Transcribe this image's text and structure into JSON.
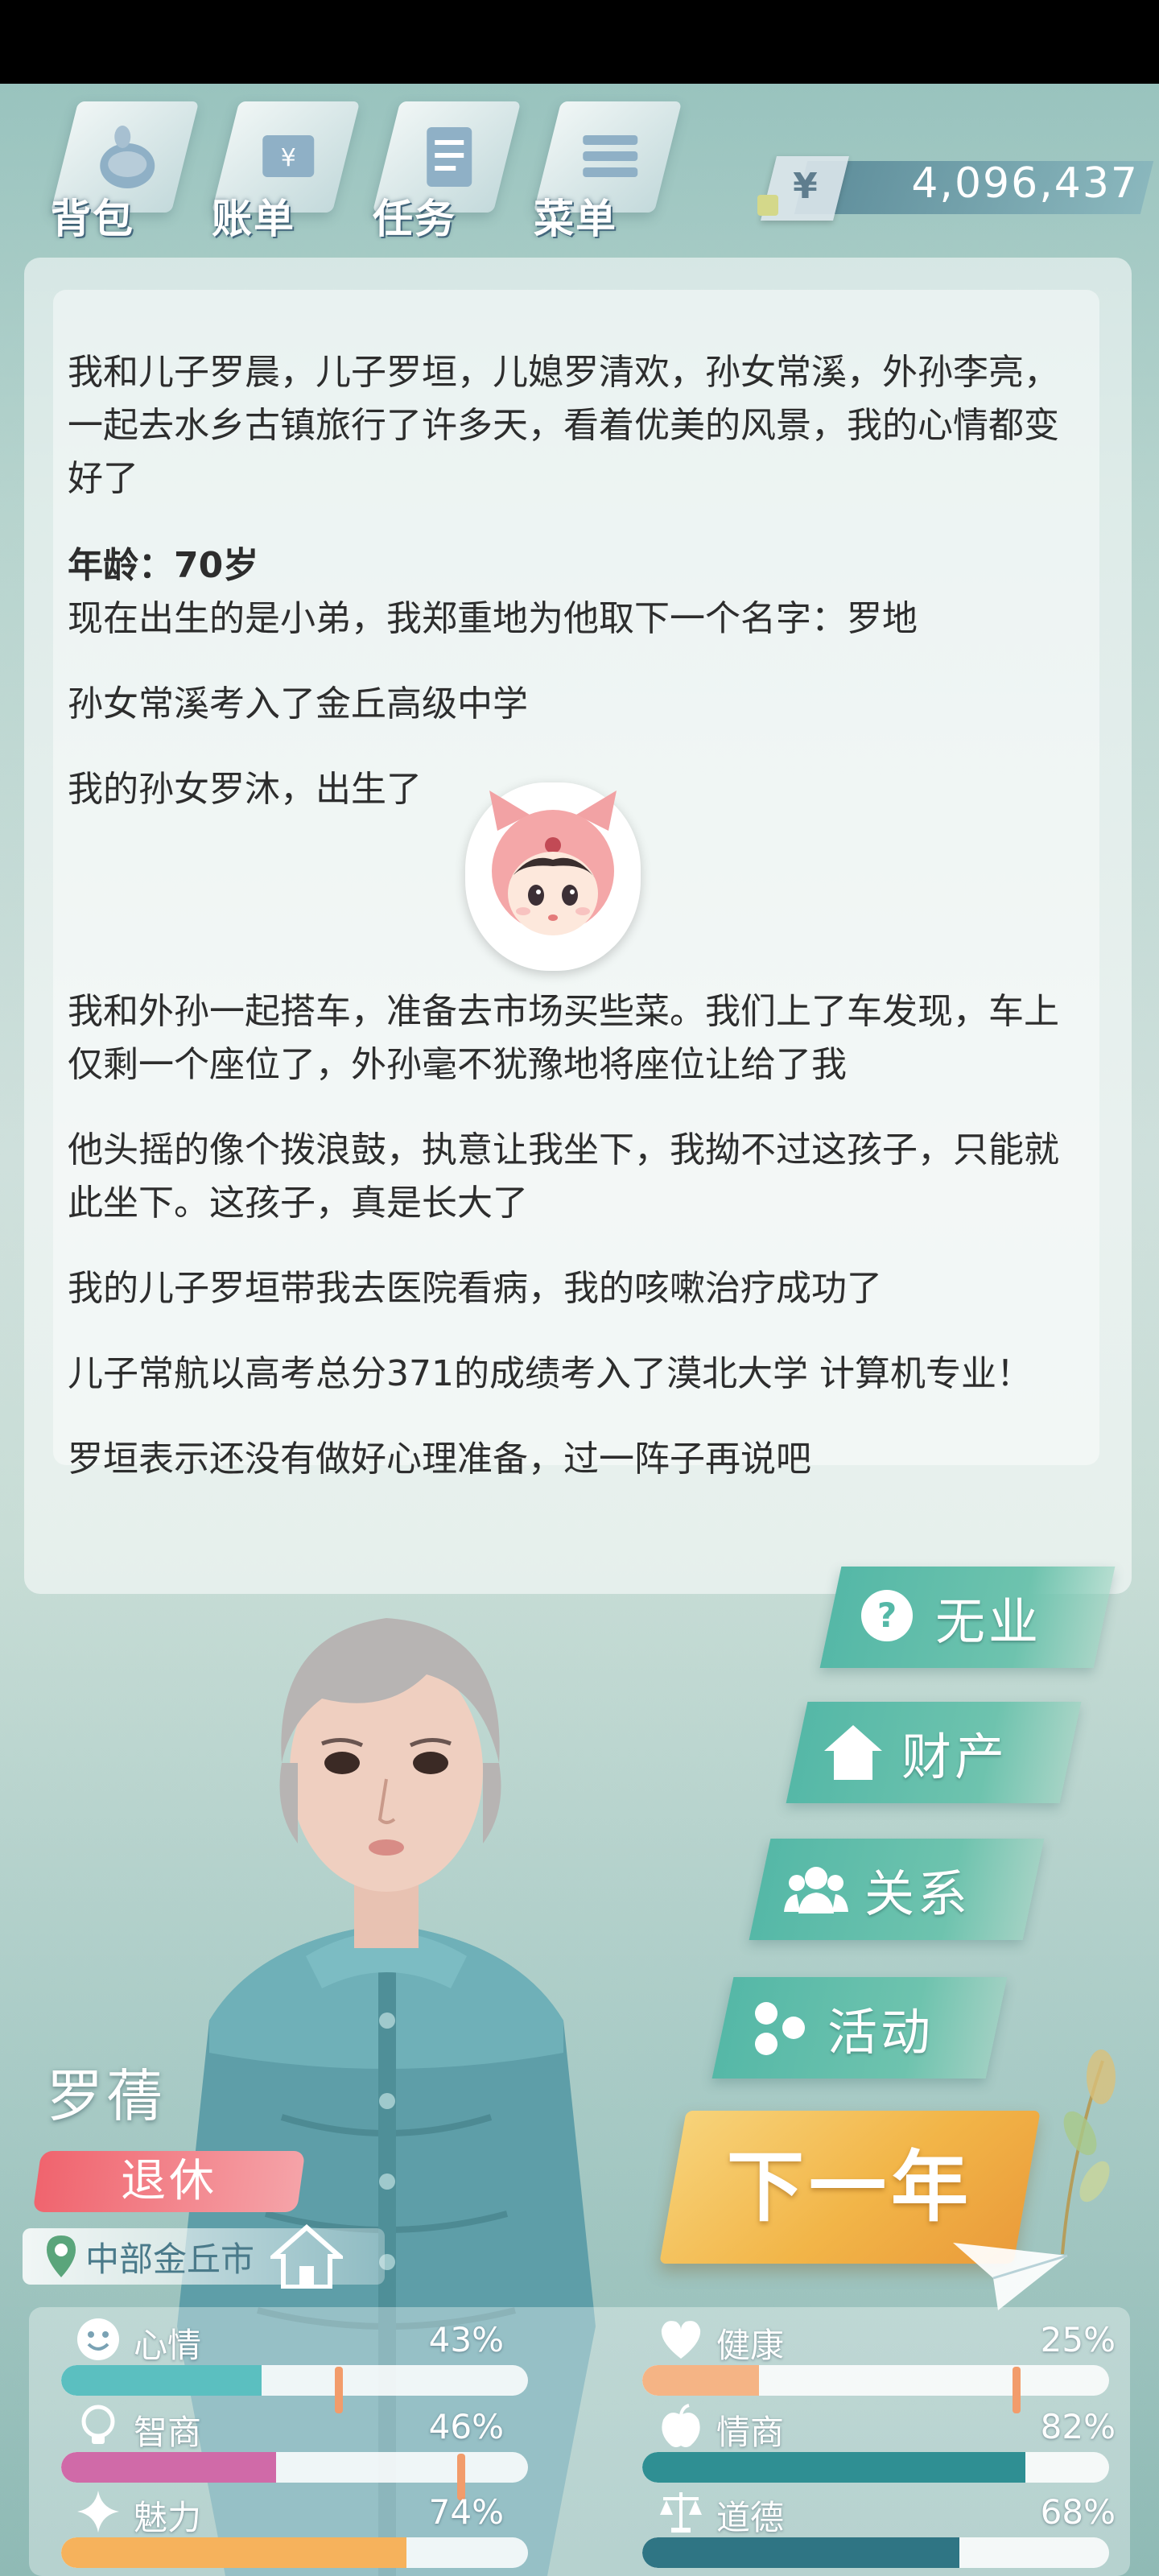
{
  "nav": {
    "items": [
      {
        "label": "背包"
      },
      {
        "label": "账单"
      },
      {
        "label": "任务"
      },
      {
        "label": "菜单"
      }
    ]
  },
  "currency": {
    "symbol": "¥",
    "amount": "4,096,437"
  },
  "log": {
    "intro": "我和儿子罗晨，儿子罗垣，儿媳罗清欢，孙女常溪，外孙李亮，一起去水乡古镇旅行了许多天，看着优美的风景，我的心情都变好了",
    "age_label": "年龄：70岁",
    "entries": [
      "现在出生的是小弟，我郑重地为他取下一个名字：罗地",
      "孙女常溪考入了金丘高级中学",
      "我的孙女罗沐，出生了",
      "我和外孙一起搭车，准备去市场买些菜。我们上了车发现，车上仅剩一个座位了，外孙毫不犹豫地将座位让给了我",
      "他头摇的像个拨浪鼓，执意让我坐下，我拗不过这孩子，只能就此坐下。这孩子，真是长大了",
      "我的儿子罗垣带我去医院看病，我的咳嗽治疗成功了",
      "儿子常航以高考总分371的成绩考入了漠北大学 计算机专业！",
      "罗垣表示还没有做好心理准备，过一阵子再说吧"
    ]
  },
  "actions": {
    "job": "无业",
    "property": "财产",
    "relations": "关系",
    "activities": "活动",
    "next_year": "下一年"
  },
  "character": {
    "name": "罗蒨",
    "status": "退休",
    "location": "中部金丘市"
  },
  "stats": {
    "mood": {
      "label": "心情",
      "value": "43%",
      "fill": 0.43,
      "color": "#5bbfc0"
    },
    "health": {
      "label": "健康",
      "value": "25%",
      "fill": 0.25,
      "color": "#f5b485"
    },
    "iq": {
      "label": "智商",
      "value": "46%",
      "fill": 0.46,
      "color": "#d06aa8"
    },
    "eq": {
      "label": "情商",
      "value": "82%",
      "fill": 0.82,
      "color": "#2f8f93"
    },
    "charm": {
      "label": "魅力",
      "value": "74%",
      "fill": 0.74,
      "color": "#f6b25c"
    },
    "morality": {
      "label": "道德",
      "value": "68%",
      "fill": 0.68,
      "color": "#2f7584"
    }
  }
}
